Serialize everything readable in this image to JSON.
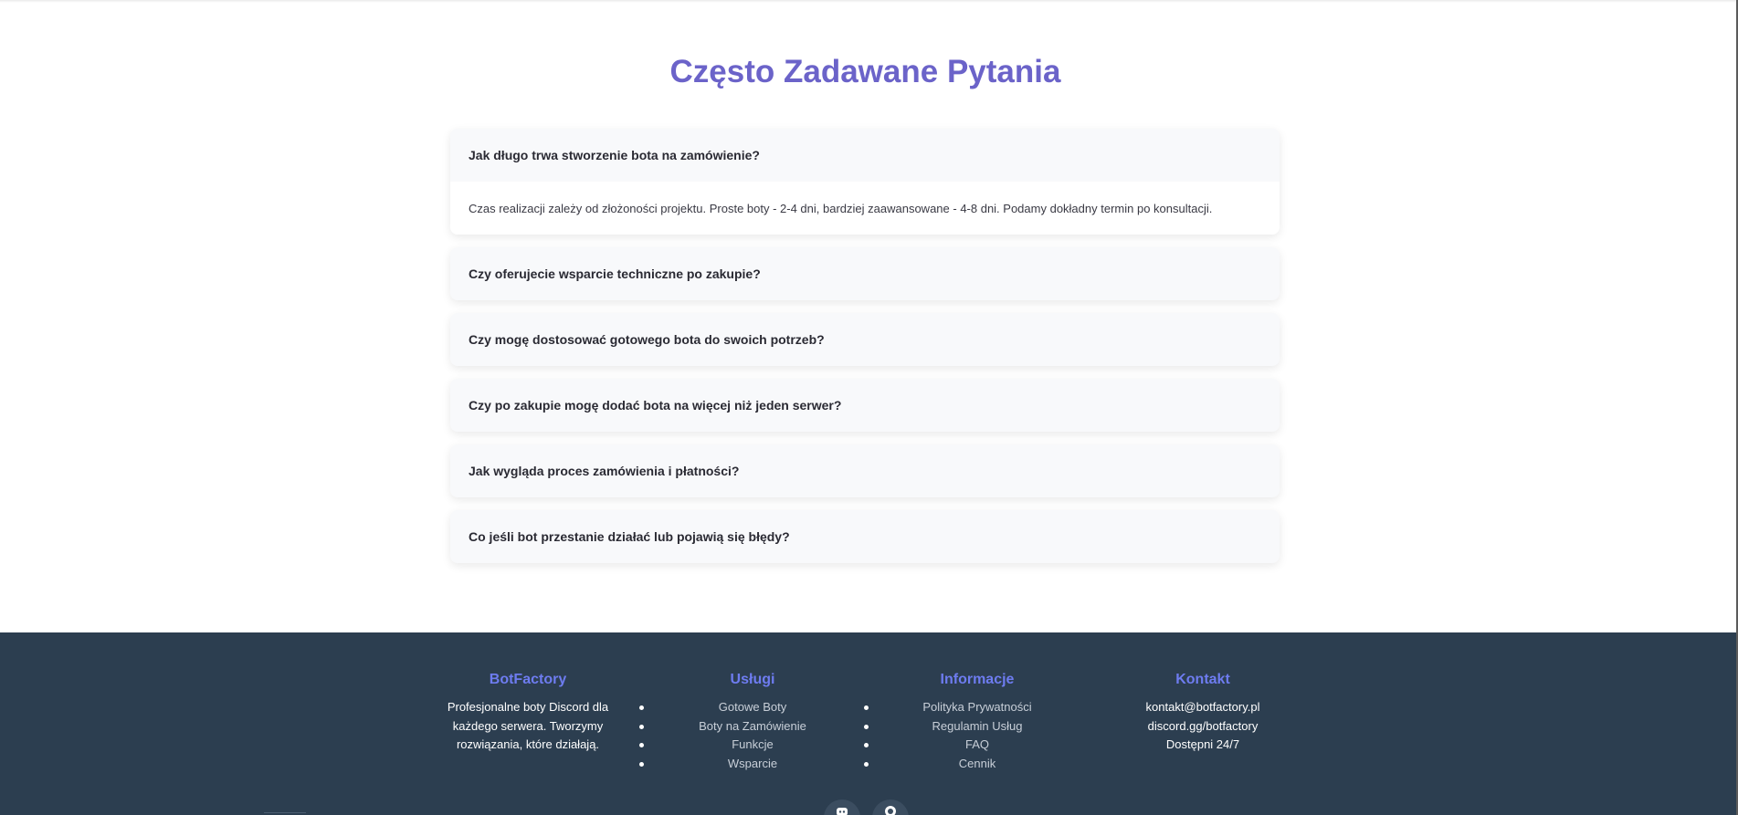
{
  "faq": {
    "title": "Często Zadawane Pytania",
    "items": [
      {
        "question": "Jak długo trwa stworzenie bota na zamówienie?",
        "answer": "Czas realizacji zależy od złożoności projektu. Proste boty - 2-4 dni, bardziej zaawansowane - 4-8 dni. Podamy dokładny termin po konsultacji.",
        "expanded": true
      },
      {
        "question": "Czy oferujecie wsparcie techniczne po zakupie?",
        "expanded": false
      },
      {
        "question": "Czy mogę dostosować gotowego bota do swoich potrzeb?",
        "expanded": false
      },
      {
        "question": "Czy po zakupie mogę dodać bota na więcej niż jeden serwer?",
        "expanded": false
      },
      {
        "question": "Jak wygląda proces zamówienia i płatności?",
        "expanded": false
      },
      {
        "question": "Co jeśli bot przestanie działać lub pojawią się błędy?",
        "expanded": false
      }
    ]
  },
  "footer": {
    "brand": {
      "heading": "BotFactory",
      "description": "Profesjonalne boty Discord dla każdego serwera. Tworzymy rozwiązania, które działają."
    },
    "services": {
      "heading": "Usługi",
      "links": [
        "Gotowe Boty",
        "Boty na Zamówienie",
        "Funkcje",
        "Wsparcie"
      ]
    },
    "info": {
      "heading": "Informacje",
      "links": [
        "Polityka Prywatności",
        "Regulamin Usług",
        "FAQ",
        "Cennik"
      ]
    },
    "contact": {
      "heading": "Kontakt",
      "lines": [
        "kontakt@botfactory.pl",
        "discord.gg/botfactory",
        "Dostępni 24/7"
      ]
    },
    "social_icons": [
      "discord-icon",
      "github-icon"
    ]
  },
  "colors": {
    "title": "#6b63c9",
    "footer_bg": "#2c3e50",
    "footer_heading": "#6e7cf0",
    "card_bg": "#f8f9fb"
  }
}
